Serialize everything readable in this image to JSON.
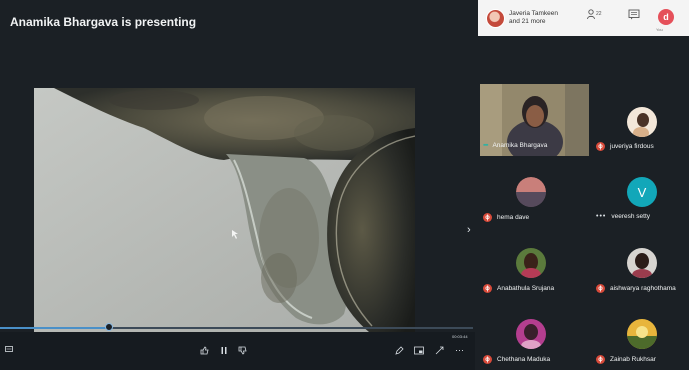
{
  "header": {
    "presenting_label": "Anamika Bhargava is presenting"
  },
  "topbar": {
    "joined_line1": "Javeria Tamkeen",
    "joined_line2": "and 21 more",
    "people_badge": "22",
    "self_initial": "d",
    "self_label": "You"
  },
  "player": {
    "time": "00:03:44",
    "progress_fraction": 0.23
  },
  "participants": [
    {
      "name": "Anamika Bhargava",
      "status": "speaking"
    },
    {
      "name": "juveriya firdous",
      "status": "muted"
    },
    {
      "name": "hema dave",
      "status": "muted"
    },
    {
      "name": "veeresh setty",
      "status": "more",
      "initial": "V"
    },
    {
      "name": "Anabathula Srujana",
      "status": "muted"
    },
    {
      "name": "aishwarya raghothama",
      "status": "muted"
    },
    {
      "name": "Chethana Maduka",
      "status": "muted"
    },
    {
      "name": "Zainab Rukhsar",
      "status": "muted"
    }
  ],
  "colors": {
    "background": "#1b2025",
    "muted_red": "#d84a3a",
    "speaking_teal": "#35b1a0",
    "veeresh_avatar": "#12a7b9"
  }
}
